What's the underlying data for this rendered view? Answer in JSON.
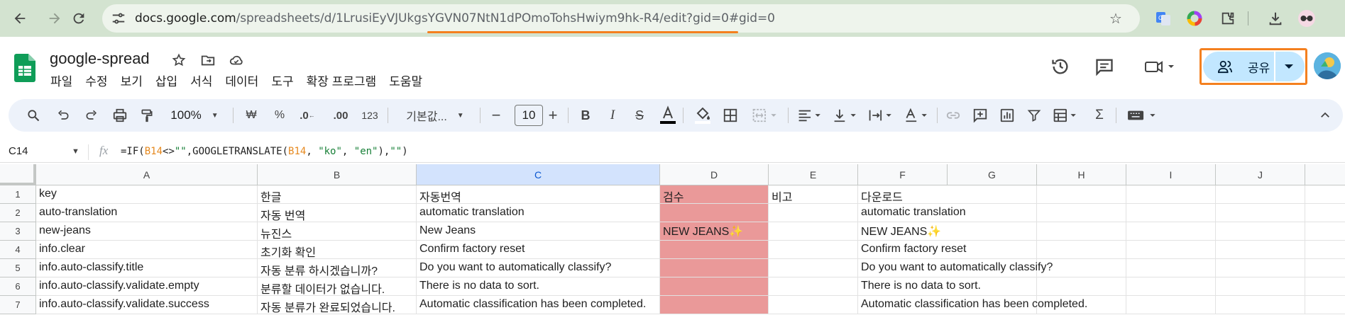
{
  "browser": {
    "url_domain": "docs.google.com",
    "url_path_prefix": "/spreadsheets/d/",
    "url_id": "1LrusiEyVJUkgsYGVN07NtN1dPOmoTohsHwiym9hk-R4",
    "url_suffix": "/edit?gid=0#gid=0",
    "accent_color": "#f4801f"
  },
  "doc": {
    "title": "google-spread",
    "menu": [
      "파일",
      "수정",
      "보기",
      "삽입",
      "서식",
      "데이터",
      "도구",
      "확장 프로그램",
      "도움말"
    ],
    "share_label": "공유"
  },
  "toolbar": {
    "zoom": "100%",
    "currency": "₩",
    "percent": "%",
    "dec_decrease": ".0",
    "dec_increase": ".00",
    "number_format": "123",
    "font_name": "기본값...",
    "font_size": "10"
  },
  "formula_bar": {
    "cell_ref": "C14",
    "fx": "fx",
    "formula_parts": [
      "=IF(",
      "B14",
      "<>",
      "\"\"",
      ",GOOGLETRANSLATE(",
      "B14",
      ", ",
      "\"ko\"",
      ", ",
      "\"en\"",
      "),",
      "\"\"",
      ")"
    ]
  },
  "sheet": {
    "columns": [
      "A",
      "B",
      "C",
      "D",
      "E",
      "F",
      "G",
      "H",
      "I",
      "J"
    ],
    "selected_column": "C",
    "highlight_color": "#ea9999",
    "rows": [
      {
        "num": "1",
        "cells": [
          "key",
          "한글",
          "자동번역",
          "검수",
          "비고",
          "다운로드"
        ]
      },
      {
        "num": "2",
        "cells": [
          "auto-translation",
          "자동 번역",
          "automatic translation",
          "",
          "",
          "automatic translation"
        ]
      },
      {
        "num": "3",
        "cells": [
          "new-jeans",
          "뉴진스",
          "New Jeans",
          "NEW JEANS✨",
          "",
          "NEW JEANS✨"
        ]
      },
      {
        "num": "4",
        "cells": [
          "info.clear",
          "초기화 확인",
          "Confirm factory reset",
          "",
          "",
          "Confirm factory reset"
        ]
      },
      {
        "num": "5",
        "cells": [
          "info.auto-classify.title",
          "자동 분류 하시겠습니까?",
          "Do you want to automatically classify?",
          "",
          "",
          "Do you want to automatically classify?"
        ]
      },
      {
        "num": "6",
        "cells": [
          "info.auto-classify.validate.empty",
          "분류할 데이터가 없습니다.",
          "There is no data to sort.",
          "",
          "",
          "There is no data to sort."
        ]
      },
      {
        "num": "7",
        "cells": [
          "info.auto-classify.validate.success",
          "자동 분류가 완료되었습니다.",
          "Automatic classification has been completed.",
          "",
          "",
          "Automatic classification has been completed."
        ]
      }
    ]
  }
}
